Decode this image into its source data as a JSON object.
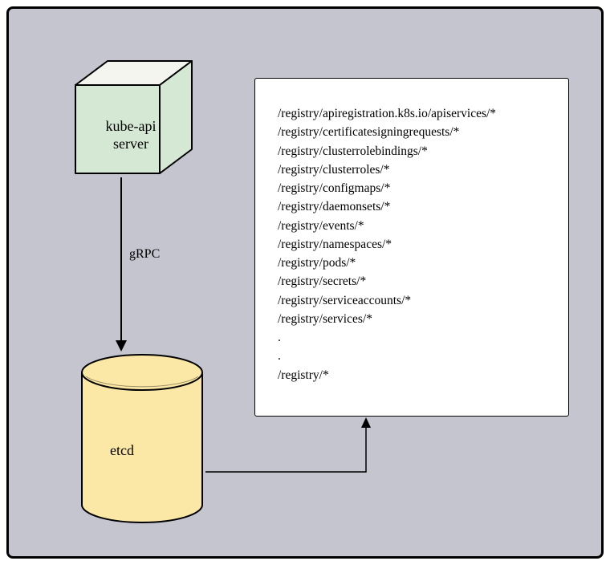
{
  "nodes": {
    "kube_api": {
      "label_line1": "kube-api",
      "label_line2": "server"
    },
    "etcd": {
      "label": "etcd"
    }
  },
  "edge": {
    "label": "gRPC"
  },
  "registry_paths": [
    "/registry/apiregistration.k8s.io/apiservices/*",
    "/registry/certificatesigningrequests/*",
    "/registry/clusterrolebindings/*",
    "/registry/clusterroles/*",
    "/registry/configmaps/*",
    "/registry/daemonsets/*",
    "/registry/events/*",
    "/registry/namespaces/*",
    "/registry/pods/*",
    "/registry/secrets/*",
    "/registry/serviceaccounts/*",
    "/registry/services/*",
    ".",
    ".",
    "/registry/*"
  ]
}
